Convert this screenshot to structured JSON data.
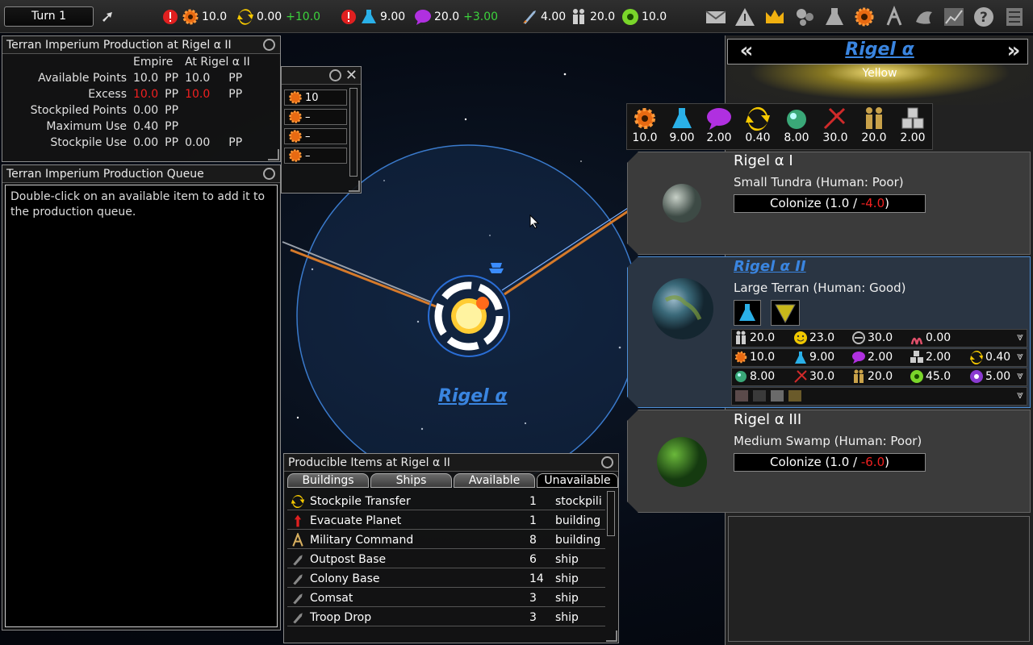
{
  "topbar": {
    "turn": "Turn 1",
    "industry": "10.0",
    "stockpile": "0.00",
    "stockpile_delta": "+10.0",
    "research": "9.00",
    "influence": "20.0",
    "influence_delta": "+3.00",
    "fleet": "4.00",
    "population": "20.0",
    "happiness": "10.0"
  },
  "production_window": {
    "title": "Terran Imperium Production at Rigel α II",
    "col_empire": "Empire",
    "col_local": "At Rigel α II",
    "rows": [
      {
        "label": "Available Points",
        "empire": "10.0",
        "empire_unit": "PP",
        "local": "10.0",
        "local_unit": "PP"
      },
      {
        "label": "Excess",
        "empire": "10.0",
        "empire_unit": "PP",
        "local": "10.0",
        "local_unit": "PP"
      },
      {
        "label": "Stockpiled Points",
        "empire": "0.00",
        "empire_unit": "PP",
        "local": "",
        "local_unit": ""
      },
      {
        "label": "Maximum Use",
        "empire": "0.40",
        "empire_unit": "PP",
        "local": "",
        "local_unit": ""
      },
      {
        "label": "Stockpile Use",
        "empire": "0.00",
        "empire_unit": "PP",
        "local": "0.00",
        "local_unit": "PP"
      }
    ]
  },
  "queue_window": {
    "title": "Terran Imperium Production Queue",
    "hint": "Double-click on an available item to add it to the production queue."
  },
  "small_window": {
    "rows": [
      "10",
      "–",
      "–",
      "–"
    ]
  },
  "available_window": {
    "title": "Producible Items at Rigel α II",
    "tabs": [
      "Buildings",
      "Ships",
      "Available",
      "Unavailable"
    ],
    "items": [
      {
        "name": "Stockpile Transfer",
        "turns": "1",
        "type": "stockpili",
        "icon": "stockpile-icon"
      },
      {
        "name": "Evacuate Planet",
        "turns": "1",
        "type": "building",
        "icon": "evacuate-icon"
      },
      {
        "name": "Military Command",
        "turns": "8",
        "type": "building",
        "icon": "military-icon"
      },
      {
        "name": "Outpost Base",
        "turns": "6",
        "type": "ship",
        "icon": "ship-icon"
      },
      {
        "name": "Colony Base",
        "turns": "14",
        "type": "ship",
        "icon": "ship-icon"
      },
      {
        "name": "Comsat",
        "turns": "3",
        "type": "ship",
        "icon": "ship-icon"
      },
      {
        "name": "Troop Drop",
        "turns": "3",
        "type": "ship",
        "icon": "ship-icon"
      }
    ]
  },
  "map": {
    "system_label": "Rigel α"
  },
  "system_panel": {
    "name": "Rigel α",
    "star_type": "Yellow",
    "summary": [
      "10.0",
      "9.00",
      "2.00",
      "0.40",
      "8.00",
      "30.0",
      "20.0",
      "2.00"
    ],
    "planets": [
      {
        "name": "Rigel α I",
        "desc": "Small Tundra (Human: Poor)",
        "colonize_prefix": "Colonize (1.0 / ",
        "colonize_value": "-4.0",
        "colonize_suffix": ")"
      },
      {
        "name": "Rigel α II",
        "desc": "Large Terran (Human: Good)",
        "stats_row1": [
          "20.0",
          "23.0",
          "30.0",
          "0.00"
        ],
        "stats_row2": [
          "10.0",
          "9.00",
          "2.00",
          "2.00",
          "0.40"
        ],
        "stats_row3": [
          "8.00",
          "30.0",
          "20.0",
          "45.0",
          "5.00"
        ]
      },
      {
        "name": "Rigel α III",
        "desc": "Medium Swamp (Human: Poor)",
        "colonize_prefix": "Colonize (1.0 / ",
        "colonize_value": "-6.0",
        "colonize_suffix": ")"
      }
    ]
  },
  "colors": {
    "accent_blue": "#3a85e0",
    "positive": "#3cd33c",
    "negative": "#f02020"
  }
}
